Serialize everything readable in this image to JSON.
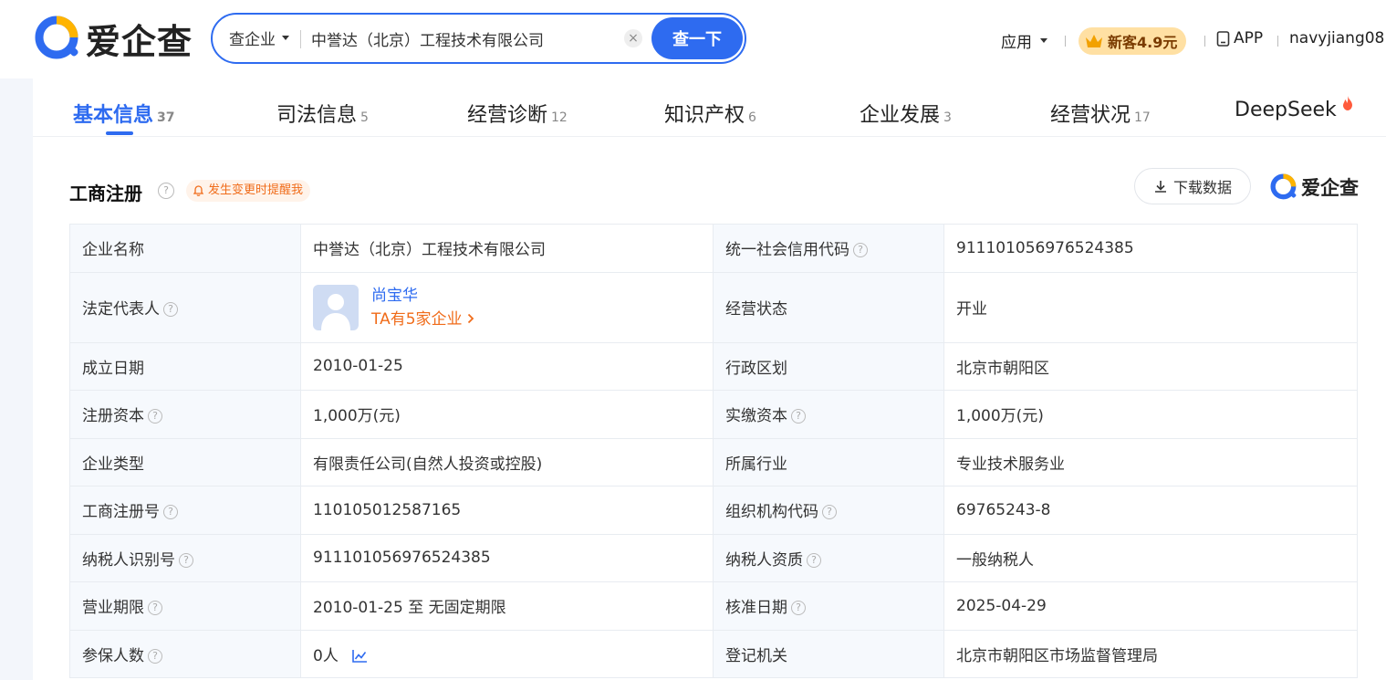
{
  "header": {
    "logo_text": "爱企查",
    "search": {
      "type_label": "查企业",
      "value": "中誉达（北京）工程技术有限公司",
      "clear": "×",
      "button": "查一下"
    },
    "apps": "应用",
    "promo": "新客4.9元",
    "app_link": "APP",
    "user": "navyjiang08..."
  },
  "tabs": [
    {
      "label": "基本信息",
      "count": "37"
    },
    {
      "label": "司法信息",
      "count": "5"
    },
    {
      "label": "经营诊断",
      "count": "12"
    },
    {
      "label": "知识产权",
      "count": "6"
    },
    {
      "label": "企业发展",
      "count": "3"
    },
    {
      "label": "经营状况",
      "count": "17"
    },
    {
      "label": "DeepSeek",
      "count": ""
    }
  ],
  "section": {
    "title": "工商注册",
    "help": "?",
    "alert": "发生变更时提醒我",
    "download": "下载数据",
    "watermark": "爱企查"
  },
  "table": {
    "r0": {
      "l1": "企业名称",
      "v1": "中誉达（北京）工程技术有限公司",
      "l2": "统一社会信用代码",
      "v2": "911101056976524385"
    },
    "r1": {
      "l1": "法定代表人",
      "name": "尚宝华",
      "more": "TA有5家企业",
      "l2": "经营状态",
      "v2": "开业"
    },
    "r2": {
      "l1": "成立日期",
      "v1": "2010-01-25",
      "l2": "行政区划",
      "v2": "北京市朝阳区"
    },
    "r3": {
      "l1": "注册资本",
      "v1": "1,000万(元)",
      "l2": "实缴资本",
      "v2": "1,000万(元)"
    },
    "r4": {
      "l1": "企业类型",
      "v1": "有限责任公司(自然人投资或控股)",
      "l2": "所属行业",
      "v2": "专业技术服务业"
    },
    "r5": {
      "l1": "工商注册号",
      "v1": "110105012587165",
      "l2": "组织机构代码",
      "v2": "69765243-8"
    },
    "r6": {
      "l1": "纳税人识别号",
      "v1": "911101056976524385",
      "l2": "纳税人资质",
      "v2": "一般纳税人"
    },
    "r7": {
      "l1": "营业期限",
      "v1": "2010-01-25 至 无固定期限",
      "l2": "核准日期",
      "v2": "2025-04-29"
    },
    "r8": {
      "l1": "参保人数",
      "v1": "0人",
      "l2": "登记机关",
      "v2": "北京市朝阳区市场监督管理局"
    }
  },
  "colors": {
    "accent": "#2e6bf0",
    "orange": "#f06c1a",
    "label_bg": "#f6f9fd"
  }
}
